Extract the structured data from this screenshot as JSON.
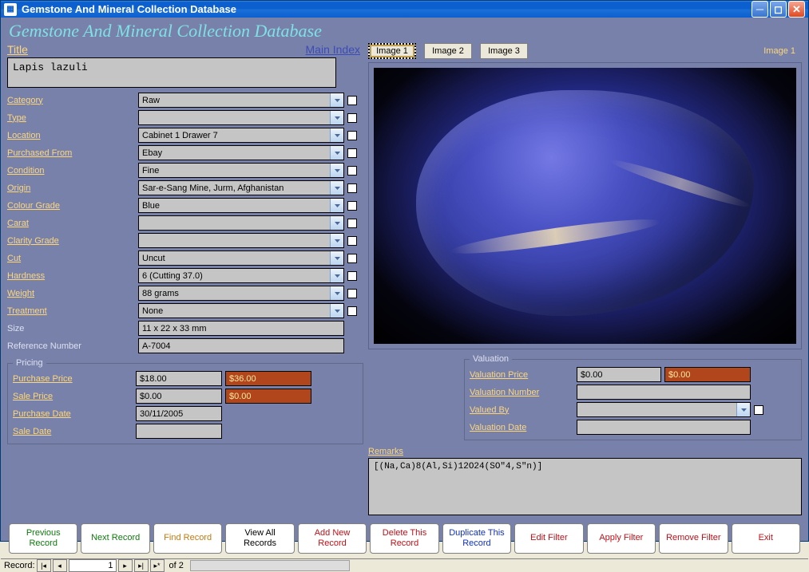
{
  "window": {
    "title": "Gemstone And Mineral Collection Database"
  },
  "appTitle": "Gemstone And Mineral Collection Database",
  "mainIndex": "Main Index",
  "labels": {
    "title": "Title",
    "category": "Category",
    "type": "Type",
    "location": "Location",
    "purchasedFrom": "Purchased From",
    "condition": "Condition",
    "origin": "Origin",
    "colourGrade": "Colour Grade",
    "carat": "Carat",
    "clarityGrade": "Clarity Grade",
    "cut": "Cut",
    "hardness": "Hardness",
    "weight": "Weight",
    "treatment": "Treatment",
    "size": "Size",
    "referenceNumber": "Reference Number",
    "pricing": "Pricing",
    "purchasePrice": "Purchase Price",
    "salePrice": "Sale Price",
    "purchaseDate": "Purchase Date",
    "saleDate": "Sale Date",
    "valuation": "Valuation",
    "valuationPrice": "Valuation Price",
    "valuationNumber": "Valuation Number",
    "valuedBy": "Valued By",
    "valuationDate": "Valuation Date",
    "remarks": "Remarks"
  },
  "values": {
    "title": "Lapis lazuli",
    "category": "Raw",
    "type": "",
    "location": "Cabinet 1 Drawer 7",
    "purchasedFrom": "Ebay",
    "condition": "Fine",
    "origin": "Sar-e-Sang Mine, Jurm, Afghanistan",
    "colourGrade": "Blue",
    "carat": "",
    "clarityGrade": "",
    "cut": "Uncut",
    "hardness": "6 (Cutting 37.0)",
    "weight": "88 grams",
    "treatment": "None",
    "size": "11 x 22 x 33 mm",
    "referenceNumber": "A-7004",
    "purchasePrice": "$18.00",
    "purchasePriceAlt": "$36.00",
    "salePrice": "$0.00",
    "salePriceAlt": "$0.00",
    "purchaseDate": "30/11/2005",
    "saleDate": "",
    "valuationPrice": "$0.00",
    "valuationPriceAlt": "$0.00",
    "valuationNumber": "",
    "valuedBy": "",
    "valuationDate": "",
    "remarks": "[(Na,Ca)8(Al,Si)12O24(SO\"4,S\"n)]"
  },
  "imageTabs": {
    "t1": "Image 1",
    "t2": "Image 2",
    "t3": "Image 3",
    "current": "Image 1"
  },
  "buttons": {
    "prev": "Previous Record",
    "next": "Next Record",
    "find": "Find Record",
    "viewAll": "View All Records",
    "addNew": "Add New Record",
    "deleteThis": "Delete This Record",
    "duplicate": "Duplicate This  Record",
    "editFilter": "Edit Filter",
    "applyFilter": "Apply Filter",
    "removeFilter": "Remove Filter",
    "exit": "Exit"
  },
  "recordNav": {
    "label": "Record:",
    "current": "1",
    "ofText": "of  2"
  }
}
